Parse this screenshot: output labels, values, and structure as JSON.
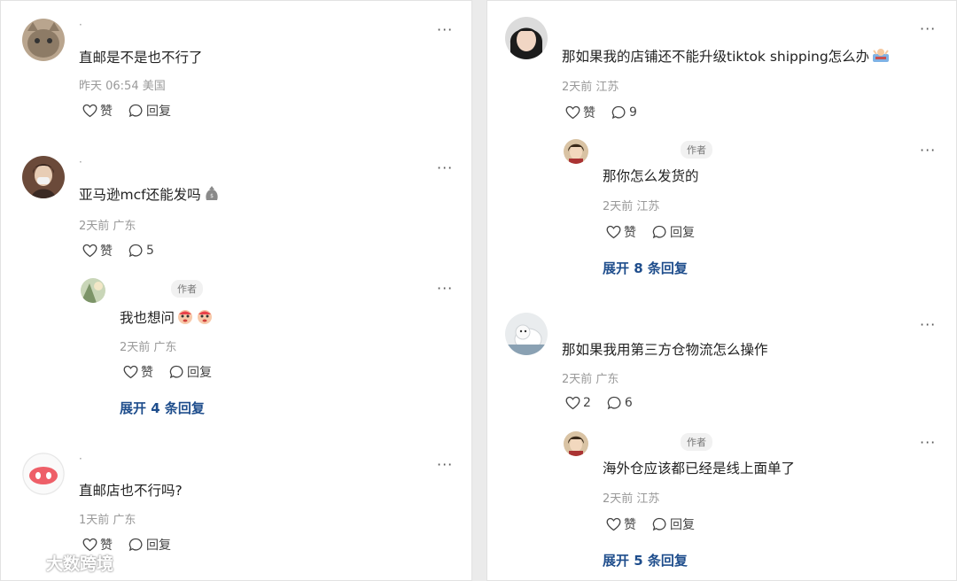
{
  "labels": {
    "like": "赞",
    "reply": "回复",
    "author": "作者",
    "more": "···"
  },
  "left": {
    "comments": [
      {
        "username": "·",
        "text": "直邮是不是也不行了",
        "time": "昨天 06:54",
        "location": "美国",
        "like": "赞",
        "reply": "回复"
      },
      {
        "username": "·",
        "text": "亚马逊mcf还能发吗",
        "time": "2天前",
        "location": "广东",
        "like": "赞",
        "reply": "5",
        "replies": [
          {
            "text": "我也想问",
            "time": "2天前",
            "location": "广东",
            "like": "赞",
            "reply": "回复"
          }
        ],
        "expand": "展开 4 条回复"
      },
      {
        "username": "·",
        "text": "直邮店也不行吗?",
        "time": "1天前",
        "location": "广东",
        "like": "赞",
        "reply": "回复"
      }
    ]
  },
  "right": {
    "comments": [
      {
        "text": "那如果我的店铺还不能升级tiktok shipping怎么办",
        "time": "2天前",
        "location": "江苏",
        "like": "赞",
        "reply": "9",
        "replies": [
          {
            "text": "那你怎么发货的",
            "time": "2天前",
            "location": "江苏",
            "like": "赞",
            "reply": "回复"
          }
        ],
        "expand": "展开 8 条回复"
      },
      {
        "text": "那如果我用第三方仓物流怎么操作",
        "time": "2天前",
        "location": "广东",
        "like": "2",
        "reply": "6",
        "replies": [
          {
            "text": "海外仓应该都已经是线上面单了",
            "time": "2天前",
            "location": "江苏",
            "like": "赞",
            "reply": "回复"
          }
        ],
        "expand": "展开 5 条回复"
      }
    ]
  },
  "watermark": "大数跨境",
  "icons": [
    "heart-icon",
    "comment-bubble-icon",
    "more-icon",
    "emoji-icon"
  ]
}
